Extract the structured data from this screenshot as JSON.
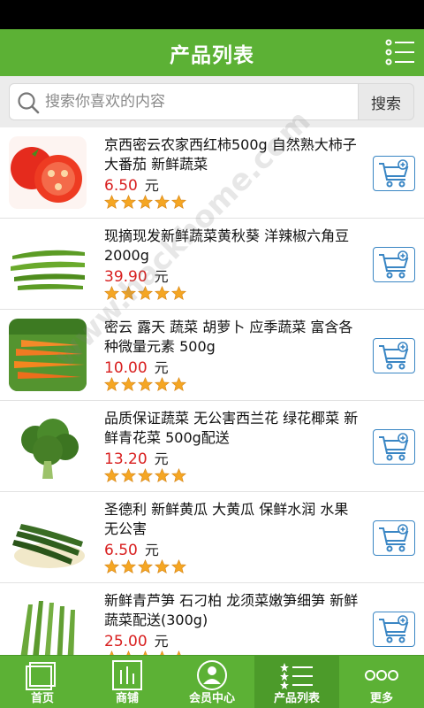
{
  "header": {
    "title": "产品列表",
    "menu_icon": "list-menu-icon"
  },
  "search": {
    "placeholder": "搜索你喜欢的内容",
    "button_label": "搜索"
  },
  "currency_unit": "元",
  "products": [
    {
      "name": "京西密云农家西红柿500g 自然熟大柿子大番茄 新鲜蔬菜",
      "price": "6.50",
      "rating": 5
    },
    {
      "name": "现摘现发新鲜蔬菜黄秋葵 洋辣椒六角豆2000g",
      "price": "39.90",
      "rating": 5
    },
    {
      "name": "密云 露天 蔬菜 胡萝卜 应季蔬菜 富含各种微量元素 500g",
      "price": "10.00",
      "rating": 5
    },
    {
      "name": "品质保证蔬菜 无公害西兰花 绿花椰菜 新鲜青花菜 500g配送",
      "price": "13.20",
      "rating": 5
    },
    {
      "name": "圣德利 新鲜黄瓜 大黄瓜 保鲜水润 水果 无公害",
      "price": "6.50",
      "rating": 5
    },
    {
      "name": " 新鲜青芦笋 石刁柏 龙须菜嫩笋细笋 新鲜蔬菜配送(300g)",
      "price": "25.00",
      "rating": 5
    }
  ],
  "tabbar": [
    {
      "label": "首页",
      "icon": "home-icon",
      "active": false
    },
    {
      "label": "商铺",
      "icon": "shop-icon",
      "active": false
    },
    {
      "label": "会员中心",
      "icon": "member-icon",
      "active": false
    },
    {
      "label": "产品列表",
      "icon": "product-list-icon",
      "active": true
    },
    {
      "label": "更多",
      "icon": "more-icon",
      "active": false
    }
  ],
  "watermark": {
    "text": "www.hackhome.com"
  },
  "colors": {
    "brand_green": "#5cb135",
    "price_red": "#d81e1e",
    "cart_blue": "#3a86c4",
    "star_orange": "#f5a623"
  }
}
